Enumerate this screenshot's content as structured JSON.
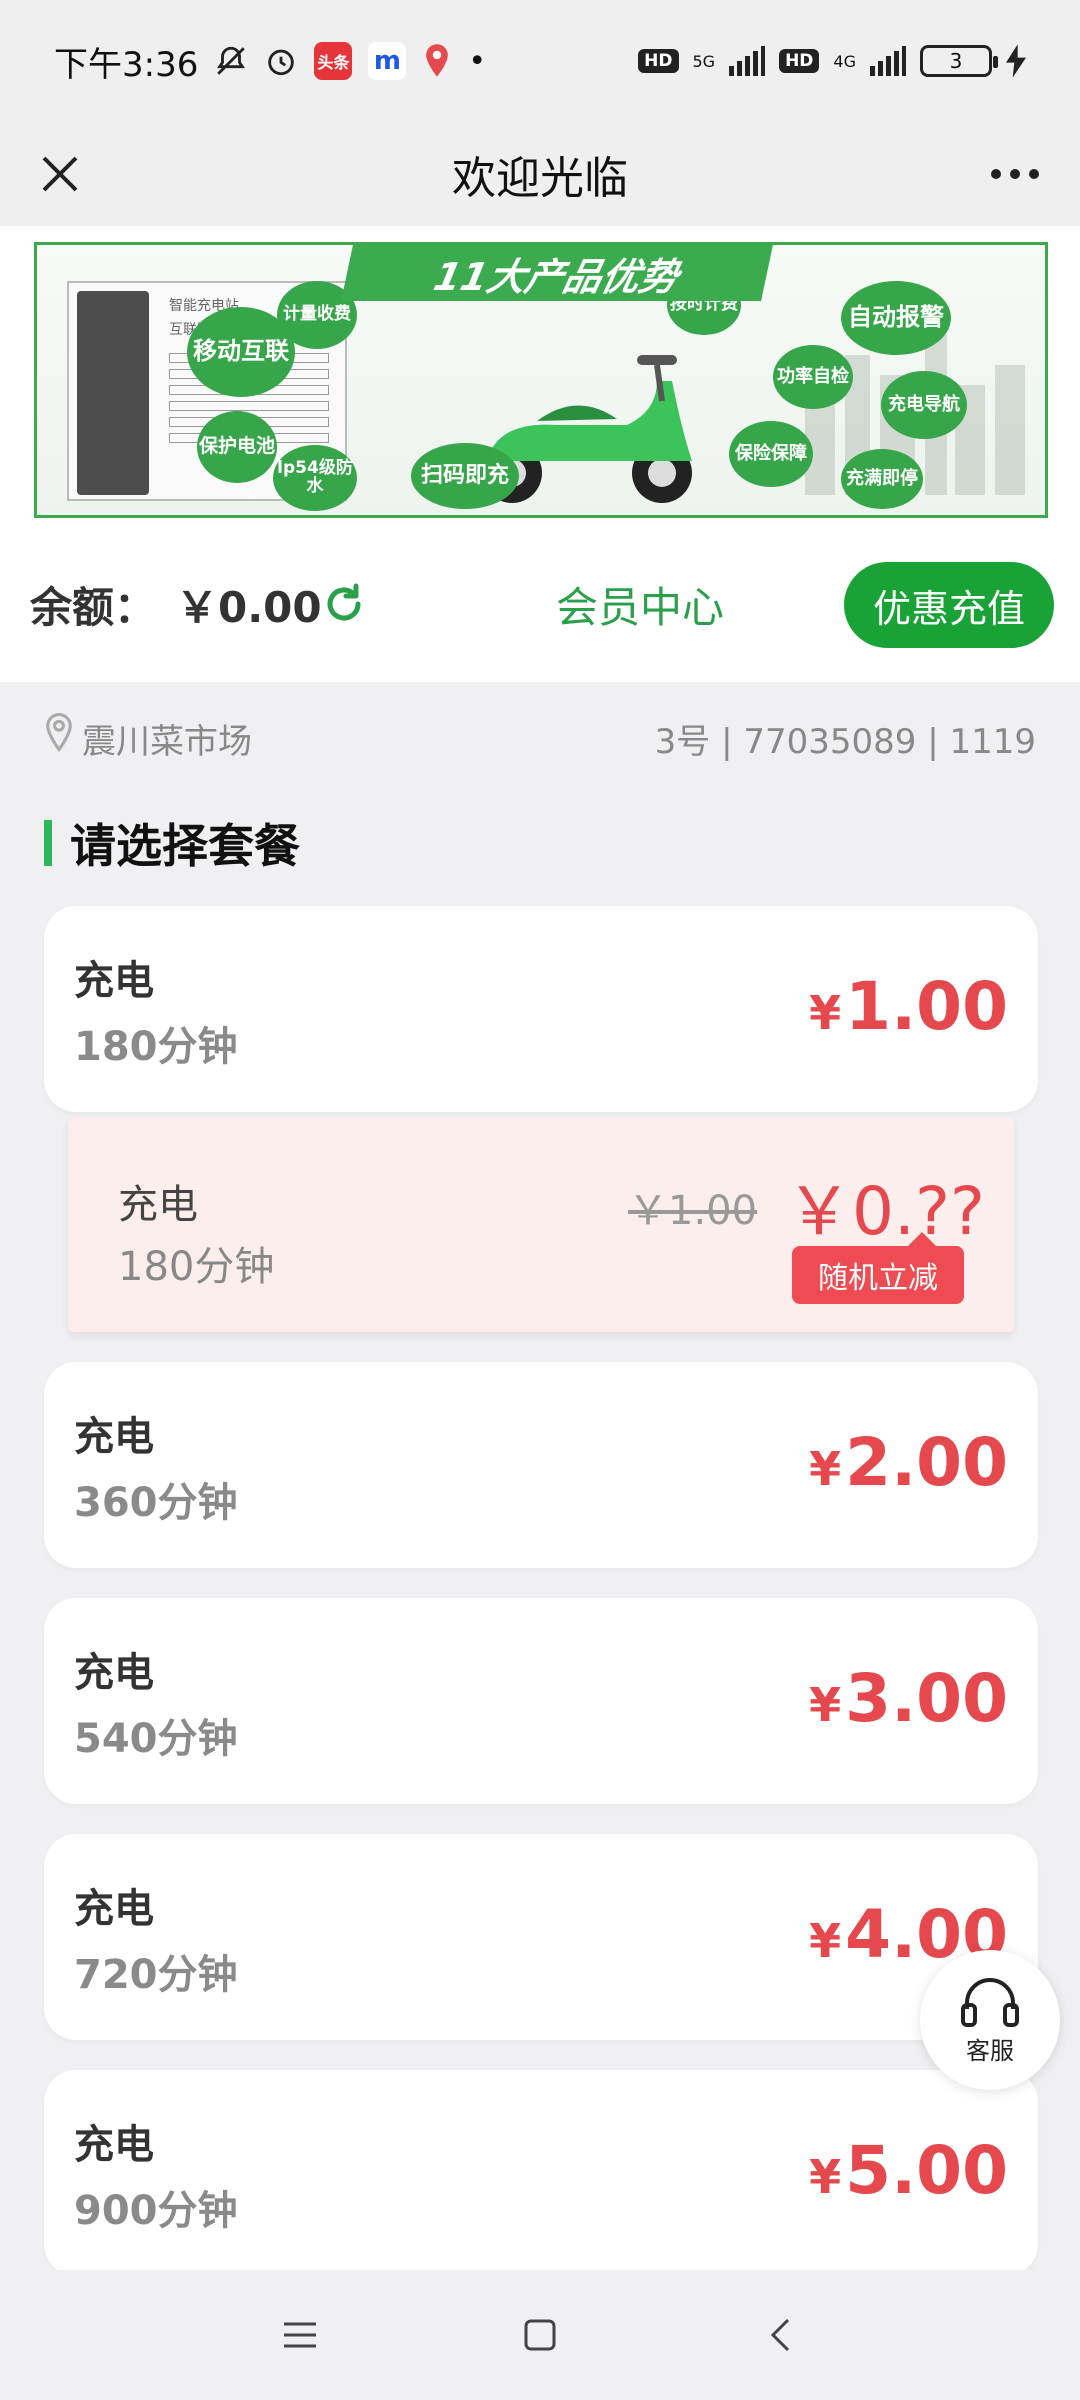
{
  "status_bar": {
    "time": "下午3:36",
    "app_badges": [
      "头条",
      "m",
      "地图"
    ],
    "network": [
      "5G",
      "4G"
    ],
    "hd": "HD",
    "battery": "3"
  },
  "nav": {
    "title": "欢迎光临"
  },
  "banner": {
    "title": "11大产品优势",
    "kiosk_title": "智能充电站",
    "kiosk_subtitle": "互联网+智慧充电",
    "features": [
      "计量收费",
      "按时计费",
      "自动报警",
      "移动互联",
      "功率自检",
      "充电导航",
      "保护电池",
      "保险保障",
      "扫码即充",
      "充满即停",
      "lp54级防水"
    ]
  },
  "balance": {
    "label": "余额：",
    "value": "￥0.00",
    "member_center": "会员中心",
    "recharge_button": "优惠充值"
  },
  "location": {
    "name": "震川菜市场",
    "code": "3号 | 77035089 | 1119"
  },
  "section_title": "请选择套餐",
  "packages": [
    {
      "name": "充电",
      "duration": "180分钟",
      "currency": "¥",
      "price": "1.00"
    },
    {
      "name": "充电",
      "duration": "360分钟",
      "currency": "¥",
      "price": "2.00"
    },
    {
      "name": "充电",
      "duration": "540分钟",
      "currency": "¥",
      "price": "3.00"
    },
    {
      "name": "充电",
      "duration": "720分钟",
      "currency": "¥",
      "price": "4.00"
    },
    {
      "name": "充电",
      "duration": "900分钟",
      "currency": "¥",
      "price": "5.00"
    }
  ],
  "promo": {
    "name": "充电",
    "duration": "180分钟",
    "old_price": "￥1.00",
    "new_price": "￥0.??",
    "tag": "随机立减"
  },
  "service": {
    "label": "客服"
  },
  "colors": {
    "accent_green": "#19a336",
    "price_red": "#e5484d",
    "promo_bg": "#fdeeee"
  }
}
